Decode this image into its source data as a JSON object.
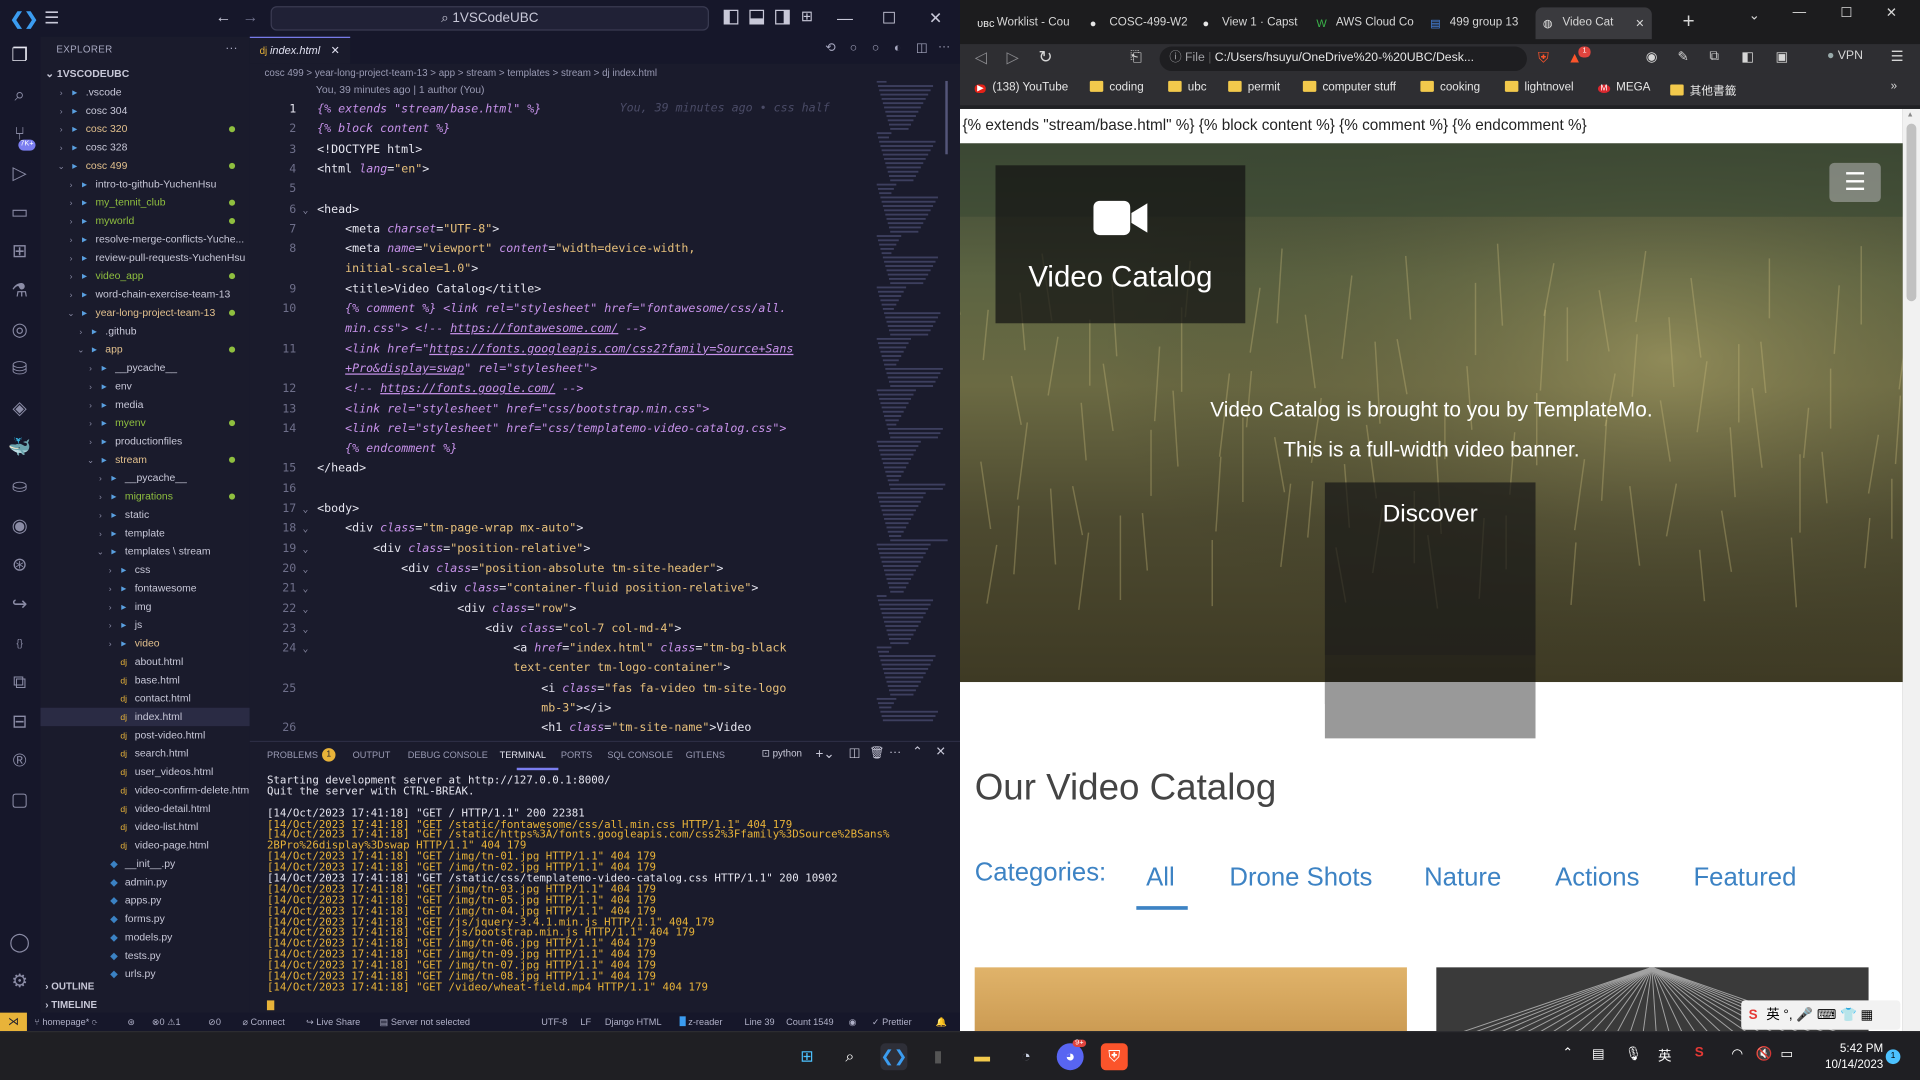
{
  "vscode": {
    "search_text": "1VSCodeUBC",
    "explorer_label": "EXPLORER",
    "workspace": "1VSCODEUBC",
    "outline": "OUTLINE",
    "timeline": "TIMELINE",
    "tree": [
      {
        "label": ".vscode",
        "indent": 1,
        "type": "folder",
        "chev": ">",
        "color": "#c8c8d8"
      },
      {
        "label": "cosc 304",
        "indent": 1,
        "type": "folder",
        "chev": ">",
        "color": "#c8c8d8"
      },
      {
        "label": "cosc 320",
        "indent": 1,
        "type": "folder",
        "chev": ">",
        "color": "#e2c08d",
        "dot": true
      },
      {
        "label": "cosc 328",
        "indent": 1,
        "type": "folder",
        "chev": ">",
        "color": "#c8c8d8"
      },
      {
        "label": "cosc 499",
        "indent": 1,
        "type": "folder",
        "chev": "v",
        "color": "#e2c08d",
        "dot": true
      },
      {
        "label": "intro-to-github-YuchenHsu",
        "indent": 2,
        "type": "folder",
        "chev": ">",
        "color": "#c8c8d8"
      },
      {
        "label": "my_tennit_club",
        "indent": 2,
        "type": "folder",
        "chev": ">",
        "color": "#8fbf3f",
        "dot": true
      },
      {
        "label": "myworld",
        "indent": 2,
        "type": "folder",
        "chev": ">",
        "color": "#8fbf3f",
        "dot": true
      },
      {
        "label": "resolve-merge-conflicts-Yuche...",
        "indent": 2,
        "type": "folder",
        "chev": ">",
        "color": "#c8c8d8"
      },
      {
        "label": "review-pull-requests-YuchenHsu",
        "indent": 2,
        "type": "folder",
        "chev": ">",
        "color": "#c8c8d8"
      },
      {
        "label": "video_app",
        "indent": 2,
        "type": "folder",
        "chev": ">",
        "color": "#8fbf3f",
        "dot": true
      },
      {
        "label": "word-chain-exercise-team-13",
        "indent": 2,
        "type": "folder",
        "chev": ">",
        "color": "#c8c8d8"
      },
      {
        "label": "year-long-project-team-13",
        "indent": 2,
        "type": "folder",
        "chev": "v",
        "color": "#e2c08d",
        "dot": true
      },
      {
        "label": ".github",
        "indent": 3,
        "type": "folder",
        "chev": ">",
        "color": "#c8c8d8"
      },
      {
        "label": "app",
        "indent": 3,
        "type": "folder",
        "chev": "v",
        "color": "#e2c08d",
        "dot": true
      },
      {
        "label": "__pycache__",
        "indent": 4,
        "type": "folder",
        "chev": ">",
        "color": "#c8c8d8"
      },
      {
        "label": "env",
        "indent": 4,
        "type": "folder",
        "chev": ">",
        "color": "#c8c8d8"
      },
      {
        "label": "media",
        "indent": 4,
        "type": "folder",
        "chev": ">",
        "color": "#c8c8d8"
      },
      {
        "label": "myenv",
        "indent": 4,
        "type": "folder",
        "chev": ">",
        "color": "#8fbf3f",
        "dot": true
      },
      {
        "label": "productionfiles",
        "indent": 4,
        "type": "folder",
        "chev": ">",
        "color": "#c8c8d8"
      },
      {
        "label": "stream",
        "indent": 4,
        "type": "folder",
        "chev": "v",
        "color": "#e2c08d",
        "dot": true
      },
      {
        "label": "__pycache__",
        "indent": 5,
        "type": "folder",
        "chev": ">",
        "color": "#c8c8d8"
      },
      {
        "label": "migrations",
        "indent": 5,
        "type": "folder",
        "chev": ">",
        "color": "#8fbf3f",
        "dot": true
      },
      {
        "label": "static",
        "indent": 5,
        "type": "folder",
        "chev": ">",
        "color": "#c8c8d8"
      },
      {
        "label": "template",
        "indent": 5,
        "type": "folder",
        "chev": ">",
        "color": "#c8c8d8"
      },
      {
        "label": "templates \\ stream",
        "indent": 5,
        "type": "folder",
        "chev": "v",
        "color": "#c8c8d8"
      },
      {
        "label": "css",
        "indent": 6,
        "type": "folder",
        "chev": ">",
        "color": "#c8c8d8"
      },
      {
        "label": "fontawesome",
        "indent": 6,
        "type": "folder",
        "chev": ">",
        "color": "#c8c8d8"
      },
      {
        "label": "img",
        "indent": 6,
        "type": "folder",
        "chev": ">",
        "color": "#c8c8d8"
      },
      {
        "label": "js",
        "indent": 6,
        "type": "folder",
        "chev": ">",
        "color": "#c8c8d8"
      },
      {
        "label": "video",
        "indent": 6,
        "type": "folder",
        "chev": ">",
        "color": "#e2c08d"
      },
      {
        "label": "about.html",
        "indent": 6,
        "type": "file",
        "color": "#c8c8d8"
      },
      {
        "label": "base.html",
        "indent": 6,
        "type": "file",
        "color": "#c8c8d8"
      },
      {
        "label": "contact.html",
        "indent": 6,
        "type": "file",
        "color": "#c8c8d8"
      },
      {
        "label": "index.html",
        "indent": 6,
        "type": "file",
        "color": "#c8c8d8",
        "selected": true
      },
      {
        "label": "post-video.html",
        "indent": 6,
        "type": "file",
        "color": "#c8c8d8"
      },
      {
        "label": "search.html",
        "indent": 6,
        "type": "file",
        "color": "#c8c8d8"
      },
      {
        "label": "user_videos.html",
        "indent": 6,
        "type": "file",
        "color": "#c8c8d8"
      },
      {
        "label": "video-confirm-delete.html",
        "indent": 6,
        "type": "file",
        "color": "#c8c8d8"
      },
      {
        "label": "video-detail.html",
        "indent": 6,
        "type": "file",
        "color": "#c8c8d8"
      },
      {
        "label": "video-list.html",
        "indent": 6,
        "type": "file",
        "color": "#c8c8d8"
      },
      {
        "label": "video-page.html",
        "indent": 6,
        "type": "file",
        "color": "#c8c8d8"
      },
      {
        "label": "__init__.py",
        "indent": 5,
        "type": "py",
        "color": "#c8c8d8"
      },
      {
        "label": "admin.py",
        "indent": 5,
        "type": "py",
        "color": "#c8c8d8"
      },
      {
        "label": "apps.py",
        "indent": 5,
        "type": "py",
        "color": "#c8c8d8"
      },
      {
        "label": "forms.py",
        "indent": 5,
        "type": "py",
        "color": "#c8c8d8"
      },
      {
        "label": "models.py",
        "indent": 5,
        "type": "py",
        "color": "#c8c8d8"
      },
      {
        "label": "tests.py",
        "indent": 5,
        "type": "py",
        "color": "#c8c8d8"
      },
      {
        "label": "urls.py",
        "indent": 5,
        "type": "py",
        "color": "#c8c8d8"
      }
    ],
    "editor_tab": "index.html",
    "breadcrumb": "cosc 499 > year-long-project-team-13 > app > stream > templates > stream > dj  index.html",
    "blame": "You, 39 minutes ago | 1 author (You)",
    "inline_blame": "You, 39 minutes ago • css half",
    "code_lines": [
      {
        "n": "1",
        "fold": "",
        "html": "<span style='color:#c792ea;font-style:italic'>{% extends \"stream/base.html\" %}</span>"
      },
      {
        "n": "2",
        "fold": "",
        "html": "<span style='color:#c792ea;font-style:italic'>{% block content %}</span>"
      },
      {
        "n": "3",
        "fold": "",
        "html": "&lt;!DOCTYPE html&gt;"
      },
      {
        "n": "4",
        "fold": "",
        "html": "&lt;<span style='color:#e6e6f0'>html</span> <span style='color:#c792ea;font-style:italic'>lang</span>=<span style='color:#e7c07b'>\"en\"</span>&gt;"
      },
      {
        "n": "5",
        "fold": "",
        "html": ""
      },
      {
        "n": "6",
        "fold": "v",
        "html": "&lt;head&gt;"
      },
      {
        "n": "7",
        "fold": "",
        "html": "&nbsp;&nbsp;&nbsp;&nbsp;&lt;meta <span style='color:#c792ea;font-style:italic'>charset</span>=<span style='color:#e7c07b'>\"UTF-8\"</span>&gt;"
      },
      {
        "n": "8",
        "fold": "",
        "html": "&nbsp;&nbsp;&nbsp;&nbsp;&lt;meta <span style='color:#c792ea;font-style:italic'>name</span>=<span style='color:#e7c07b'>\"viewport\"</span> <span style='color:#c792ea;font-style:italic'>content</span>=<span style='color:#e7c07b'>\"width=device-width,</span>"
      },
      {
        "n": "",
        "fold": "",
        "html": "&nbsp;&nbsp;&nbsp;&nbsp;<span style='color:#e7c07b'>initial-scale=1.0\"</span>&gt;"
      },
      {
        "n": "9",
        "fold": "",
        "html": "&nbsp;&nbsp;&nbsp;&nbsp;&lt;title&gt;Video Catalog&lt;/title&gt;"
      },
      {
        "n": "10",
        "fold": "",
        "html": "&nbsp;&nbsp;&nbsp;&nbsp;<span style='color:#c792ea;font-style:italic'>{% comment %} &lt;link rel=\"stylesheet\" href=\"fontawesome/css/all.</span>"
      },
      {
        "n": "",
        "fold": "",
        "html": "&nbsp;&nbsp;&nbsp;&nbsp;<span style='color:#c792ea;font-style:italic'>min.css\"&gt; &lt;!-- <u>https://fontawesome.com/</u> --&gt;</span>"
      },
      {
        "n": "11",
        "fold": "",
        "html": "&nbsp;&nbsp;&nbsp;&nbsp;<span style='color:#c792ea;font-style:italic'>&lt;link href=\"<u>https://fonts.googleapis.com/css2?family=Source+Sans</u></span>"
      },
      {
        "n": "",
        "fold": "",
        "html": "&nbsp;&nbsp;&nbsp;&nbsp;<span style='color:#c792ea;font-style:italic'><u>+Pro&amp;display=swap</u>\" rel=\"stylesheet\"&gt;</span>"
      },
      {
        "n": "12",
        "fold": "",
        "html": "&nbsp;&nbsp;&nbsp;&nbsp;<span style='color:#c792ea;font-style:italic'>&lt;!-- <u>https://fonts.google.com/</u> --&gt;</span>"
      },
      {
        "n": "13",
        "fold": "",
        "html": "&nbsp;&nbsp;&nbsp;&nbsp;<span style='color:#c792ea;font-style:italic'>&lt;link rel=\"stylesheet\" href=\"css/bootstrap.min.css\"&gt;</span>"
      },
      {
        "n": "14",
        "fold": "",
        "html": "&nbsp;&nbsp;&nbsp;&nbsp;<span style='color:#c792ea;font-style:italic'>&lt;link rel=\"stylesheet\" href=\"css/templatemo-video-catalog.css\"&gt;</span>"
      },
      {
        "n": "",
        "fold": "",
        "html": "&nbsp;&nbsp;&nbsp;&nbsp;<span style='color:#c792ea;font-style:italic'>{% endcomment %}</span>"
      },
      {
        "n": "15",
        "fold": "",
        "html": "&lt;/head&gt;"
      },
      {
        "n": "16",
        "fold": "",
        "html": ""
      },
      {
        "n": "17",
        "fold": "v",
        "html": "&lt;body&gt;"
      },
      {
        "n": "18",
        "fold": "v",
        "html": "&nbsp;&nbsp;&nbsp;&nbsp;&lt;div <span style='color:#c792ea;font-style:italic'>class</span>=<span style='color:#e7c07b'>\"tm-page-wrap mx-auto\"</span>&gt;"
      },
      {
        "n": "19",
        "fold": "v",
        "html": "&nbsp;&nbsp;&nbsp;&nbsp;&nbsp;&nbsp;&nbsp;&nbsp;&lt;div <span style='color:#c792ea;font-style:italic'>class</span>=<span style='color:#e7c07b'>\"position-relative\"</span>&gt;"
      },
      {
        "n": "20",
        "fold": "v",
        "html": "&nbsp;&nbsp;&nbsp;&nbsp;&nbsp;&nbsp;&nbsp;&nbsp;&nbsp;&nbsp;&nbsp;&nbsp;&lt;div <span style='color:#c792ea;font-style:italic'>class</span>=<span style='color:#e7c07b'>\"position-absolute tm-site-header\"</span>&gt;"
      },
      {
        "n": "21",
        "fold": "v",
        "html": "&nbsp;&nbsp;&nbsp;&nbsp;&nbsp;&nbsp;&nbsp;&nbsp;&nbsp;&nbsp;&nbsp;&nbsp;&nbsp;&nbsp;&nbsp;&nbsp;&lt;div <span style='color:#c792ea;font-style:italic'>class</span>=<span style='color:#e7c07b'>\"container-fluid position-relative\"</span>&gt;"
      },
      {
        "n": "22",
        "fold": "v",
        "html": "&nbsp;&nbsp;&nbsp;&nbsp;&nbsp;&nbsp;&nbsp;&nbsp;&nbsp;&nbsp;&nbsp;&nbsp;&nbsp;&nbsp;&nbsp;&nbsp;&nbsp;&nbsp;&nbsp;&nbsp;&lt;div <span style='color:#c792ea;font-style:italic'>class</span>=<span style='color:#e7c07b'>\"row\"</span>&gt;"
      },
      {
        "n": "23",
        "fold": "v",
        "html": "&nbsp;&nbsp;&nbsp;&nbsp;&nbsp;&nbsp;&nbsp;&nbsp;&nbsp;&nbsp;&nbsp;&nbsp;&nbsp;&nbsp;&nbsp;&nbsp;&nbsp;&nbsp;&nbsp;&nbsp;&nbsp;&nbsp;&nbsp;&nbsp;&lt;div <span style='color:#c792ea;font-style:italic'>class</span>=<span style='color:#e7c07b'>\"col-7 col-md-4\"</span>&gt;"
      },
      {
        "n": "24",
        "fold": "v",
        "html": "&nbsp;&nbsp;&nbsp;&nbsp;&nbsp;&nbsp;&nbsp;&nbsp;&nbsp;&nbsp;&nbsp;&nbsp;&nbsp;&nbsp;&nbsp;&nbsp;&nbsp;&nbsp;&nbsp;&nbsp;&nbsp;&nbsp;&nbsp;&nbsp;&nbsp;&nbsp;&nbsp;&nbsp;&lt;a <span style='color:#c792ea;font-style:italic'>href</span>=<span style='color:#e7c07b'>\"index.html\"</span> <span style='color:#c792ea;font-style:italic'>class</span>=<span style='color:#e7c07b'>\"tm-bg-black</span>"
      },
      {
        "n": "",
        "fold": "",
        "html": "&nbsp;&nbsp;&nbsp;&nbsp;&nbsp;&nbsp;&nbsp;&nbsp;&nbsp;&nbsp;&nbsp;&nbsp;&nbsp;&nbsp;&nbsp;&nbsp;&nbsp;&nbsp;&nbsp;&nbsp;&nbsp;&nbsp;&nbsp;&nbsp;&nbsp;&nbsp;&nbsp;&nbsp;<span style='color:#e7c07b'>text-center tm-logo-container\"</span>&gt;"
      },
      {
        "n": "25",
        "fold": "",
        "html": "&nbsp;&nbsp;&nbsp;&nbsp;&nbsp;&nbsp;&nbsp;&nbsp;&nbsp;&nbsp;&nbsp;&nbsp;&nbsp;&nbsp;&nbsp;&nbsp;&nbsp;&nbsp;&nbsp;&nbsp;&nbsp;&nbsp;&nbsp;&nbsp;&nbsp;&nbsp;&nbsp;&nbsp;&nbsp;&nbsp;&nbsp;&nbsp;&lt;i <span style='color:#c792ea;font-style:italic'>class</span>=<span style='color:#e7c07b'>\"fas fa-video tm-site-logo</span>"
      },
      {
        "n": "",
        "fold": "",
        "html": "&nbsp;&nbsp;&nbsp;&nbsp;&nbsp;&nbsp;&nbsp;&nbsp;&nbsp;&nbsp;&nbsp;&nbsp;&nbsp;&nbsp;&nbsp;&nbsp;&nbsp;&nbsp;&nbsp;&nbsp;&nbsp;&nbsp;&nbsp;&nbsp;&nbsp;&nbsp;&nbsp;&nbsp;&nbsp;&nbsp;&nbsp;&nbsp;<span style='color:#e7c07b'>mb-3\"</span>&gt;&lt;/i&gt;"
      },
      {
        "n": "26",
        "fold": "",
        "html": "&nbsp;&nbsp;&nbsp;&nbsp;&nbsp;&nbsp;&nbsp;&nbsp;&nbsp;&nbsp;&nbsp;&nbsp;&nbsp;&nbsp;&nbsp;&nbsp;&nbsp;&nbsp;&nbsp;&nbsp;&nbsp;&nbsp;&nbsp;&nbsp;&nbsp;&nbsp;&nbsp;&nbsp;&nbsp;&nbsp;&nbsp;&nbsp;&lt;h1 <span style='color:#c792ea;font-style:italic'>class</span>=<span style='color:#e7c07b'>\"tm-site-name\"</span>&gt;Video"
      }
    ],
    "panel_tabs": [
      "PROBLEMS",
      "OUTPUT",
      "DEBUG CONSOLE",
      "TERMINAL",
      "PORTS",
      "SQL CONSOLE",
      "GITLENS"
    ],
    "problems_count": "1",
    "terminal_shell": "python",
    "terminal_lines": [
      {
        "text": "Starting development server at http://127.0.0.1:8000/",
        "color": "#e6e6f0"
      },
      {
        "text": "Quit the server with CTRL-BREAK.",
        "color": "#e6e6f0"
      },
      {
        "text": "",
        "color": "#e6e6f0"
      },
      {
        "text": "[14/Oct/2023 17:41:18] \"GET / HTTP/1.1\" 200 22381",
        "color": "#e6e6f0"
      },
      {
        "text": "[14/Oct/2023 17:41:18] \"GET /static/fontawesome/css/all.min.css HTTP/1.1\" 404 179",
        "color": "#e8b339"
      },
      {
        "text": "[14/Oct/2023 17:41:18] \"GET /static/https%3A/fonts.googleapis.com/css2%3Ffamily%3DSource%2BSans%",
        "color": "#e8b339"
      },
      {
        "text": "2BPro%26display%3Dswap HTTP/1.1\" 404 179",
        "color": "#e8b339"
      },
      {
        "text": "[14/Oct/2023 17:41:18] \"GET /img/tn-01.jpg HTTP/1.1\" 404 179",
        "color": "#e8b339"
      },
      {
        "text": "[14/Oct/2023 17:41:18] \"GET /img/tn-02.jpg HTTP/1.1\" 404 179",
        "color": "#e8b339"
      },
      {
        "text": "[14/Oct/2023 17:41:18] \"GET /static/css/templatemo-video-catalog.css HTTP/1.1\" 200 10902",
        "color": "#e6e6f0"
      },
      {
        "text": "[14/Oct/2023 17:41:18] \"GET /img/tn-03.jpg HTTP/1.1\" 404 179",
        "color": "#e8b339"
      },
      {
        "text": "[14/Oct/2023 17:41:18] \"GET /img/tn-05.jpg HTTP/1.1\" 404 179",
        "color": "#e8b339"
      },
      {
        "text": "[14/Oct/2023 17:41:18] \"GET /img/tn-04.jpg HTTP/1.1\" 404 179",
        "color": "#e8b339"
      },
      {
        "text": "[14/Oct/2023 17:41:18] \"GET /js/jquery-3.4.1.min.js HTTP/1.1\" 404 179",
        "color": "#e8b339"
      },
      {
        "text": "[14/Oct/2023 17:41:18] \"GET /js/bootstrap.min.js HTTP/1.1\" 404 179",
        "color": "#e8b339"
      },
      {
        "text": "[14/Oct/2023 17:41:18] \"GET /img/tn-06.jpg HTTP/1.1\" 404 179",
        "color": "#e8b339"
      },
      {
        "text": "[14/Oct/2023 17:41:18] \"GET /img/tn-09.jpg HTTP/1.1\" 404 179",
        "color": "#e8b339"
      },
      {
        "text": "[14/Oct/2023 17:41:18] \"GET /img/tn-07.jpg HTTP/1.1\" 404 179",
        "color": "#e8b339"
      },
      {
        "text": "[14/Oct/2023 17:41:18] \"GET /img/tn-08.jpg HTTP/1.1\" 404 179",
        "color": "#e8b339"
      },
      {
        "text": "[14/Oct/2023 17:41:18] \"GET /video/wheat-field.mp4 HTTP/1.1\" 404 179",
        "color": "#e8b339"
      }
    ],
    "status": {
      "branch": "homepage*",
      "errors": "0",
      "warnings": "1",
      "ports": "0",
      "connect": "Connect",
      "liveshare": "Live Share",
      "server": "Server not selected",
      "encoding": "UTF-8",
      "eol": "LF",
      "language": "Django HTML",
      "reader": "z-reader",
      "line": "Line 39",
      "count": "Count 1549",
      "prettier": "Prettier"
    }
  },
  "browser": {
    "tabs": [
      {
        "label": "Worklist - Cou",
        "icon": "UBC"
      },
      {
        "label": "COSC-499-W2",
        "icon": "gh"
      },
      {
        "label": "View 1 · Capst",
        "icon": "gh"
      },
      {
        "label": "AWS Cloud Co",
        "icon": "W"
      },
      {
        "label": "499 group 13",
        "icon": "doc"
      },
      {
        "label": "Video Cat",
        "icon": "globe",
        "active": true
      }
    ],
    "url_label": "File",
    "url": "C:/Users/hsuyu/OneDrive%20-%20UBC/Desk...",
    "vpn": "VPN",
    "shield_badge": "1",
    "bookmarks": [
      {
        "label": "(138) YouTube",
        "icon": "yt"
      },
      {
        "label": "coding",
        "icon": "folder"
      },
      {
        "label": "ubc",
        "icon": "folder"
      },
      {
        "label": "permit",
        "icon": "folder"
      },
      {
        "label": "computer stuff",
        "icon": "folder"
      },
      {
        "label": "cooking",
        "icon": "folder"
      },
      {
        "label": "lightnovel",
        "icon": "folder"
      },
      {
        "label": "MEGA",
        "icon": "mega"
      },
      {
        "label": "其他書籤",
        "icon": "folder"
      }
    ],
    "page": {
      "jinja_line": "{% extends \"stream/base.html\" %} {% block content %} {% comment %} {% endcomment %}",
      "logo_title": "Video Catalog",
      "hero_line1": "Video Catalog is brought to you by TemplateMo.",
      "hero_line2": "This is a full-width video banner.",
      "discover": "Discover",
      "section_title": "Our Video Catalog",
      "categories_label": "Categories:",
      "categories": [
        "All",
        "Drone Shots",
        "Nature",
        "Actions",
        "Featured"
      ]
    }
  },
  "taskbar": {
    "time": "5:42 PM",
    "date": "10/14/2023",
    "ime": "英",
    "ime2": "英",
    "notif": "1",
    "discord_badge": "9+"
  }
}
